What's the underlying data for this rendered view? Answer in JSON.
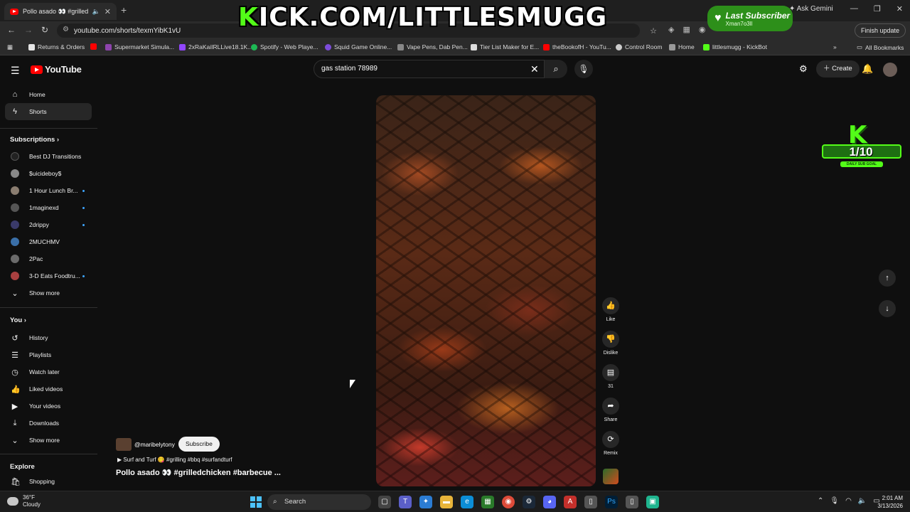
{
  "browser": {
    "tab_title": "Pollo asado 👀 #grilledchi",
    "url": "youtube.com/shorts/texmYibK1vU",
    "ask_gemini": "Ask Gemini",
    "finish_update": "Finish update",
    "bookmarks": [
      {
        "label": "Returns & Orders",
        "color": "#e5e5e5"
      },
      {
        "label": "",
        "color": "#ff0000"
      },
      {
        "label": "Supermarket Simula...",
        "color": "#8e44ad"
      },
      {
        "label": "2xRaKaiIRLLive18.1K...",
        "color": "#9146ff"
      },
      {
        "label": "Spotify - Web Playe...",
        "color": "#1db954"
      },
      {
        "label": "Squid Game Online...",
        "color": "#7d4cdb"
      },
      {
        "label": "Vape Pens, Dab Pen...",
        "color": "#888888"
      },
      {
        "label": "Tier List Maker for E...",
        "color": "#dddddd"
      },
      {
        "label": "theBookofH - YouTu...",
        "color": "#ff0000"
      },
      {
        "label": "Control Room",
        "color": "#cccccc"
      },
      {
        "label": "Home",
        "color": "#999999"
      },
      {
        "label": "littlesmugg - KickBot",
        "color": "#53fc18"
      }
    ],
    "all_bookmarks": "All Bookmarks"
  },
  "overlay": {
    "banner_k": "K",
    "banner_rest": "ICK.COM/LITTLESMUGG",
    "last_sub_title": "Last Subscriber",
    "last_sub_name": "Xman7o3ll",
    "goal_k": "K",
    "goal_count": "1/10",
    "goal_label": "DAILY SUB GOAL"
  },
  "yt": {
    "logo_text": "YouTube",
    "search_value": "gas station 78989",
    "create_label": "Create",
    "sidebar_top": [
      {
        "label": "Home",
        "icon": "home-icon",
        "glyph": "⌂",
        "active": false
      },
      {
        "label": "Shorts",
        "icon": "shorts-icon",
        "glyph": "ϟ",
        "active": true
      }
    ],
    "subscriptions_heading": "Subscriptions",
    "subscriptions": [
      {
        "label": "Best DJ Transitions",
        "color": "#222222",
        "live": false
      },
      {
        "label": "$uicideboy$",
        "color": "#888888",
        "live": false
      },
      {
        "label": "1 Hour Lunch Br...",
        "color": "#8a7d70",
        "live": true
      },
      {
        "label": "1maginexd",
        "color": "#555555",
        "live": true
      },
      {
        "label": "2drippy",
        "color": "#3a3a6a",
        "live": true
      },
      {
        "label": "2MUCHMV",
        "color": "#3a6fa8",
        "live": false
      },
      {
        "label": "2Pac",
        "color": "#6b6b6b",
        "live": false
      },
      {
        "label": "3-D Eats Foodtru...",
        "color": "#a84040",
        "live": true
      }
    ],
    "show_more": "Show more",
    "you_heading": "You",
    "you_items": [
      {
        "label": "History",
        "icon": "history-icon",
        "glyph": "↺"
      },
      {
        "label": "Playlists",
        "icon": "playlists-icon",
        "glyph": "☰"
      },
      {
        "label": "Watch later",
        "icon": "watch-later-icon",
        "glyph": "◷"
      },
      {
        "label": "Liked videos",
        "icon": "like-icon",
        "glyph": "👍"
      },
      {
        "label": "Your videos",
        "icon": "your-videos-icon",
        "glyph": "▶"
      },
      {
        "label": "Downloads",
        "icon": "download-icon",
        "glyph": "⤓"
      }
    ],
    "explore_heading": "Explore",
    "explore_items": [
      {
        "label": "Shopping",
        "icon": "shopping-icon",
        "glyph": "🛍"
      }
    ],
    "actions": [
      {
        "label": "Like",
        "icon": "like-icon",
        "glyph": "👍"
      },
      {
        "label": "Dislike",
        "icon": "dislike-icon",
        "glyph": "👎"
      },
      {
        "label": "31",
        "icon": "comment-icon",
        "glyph": "▤"
      },
      {
        "label": "Share",
        "icon": "share-icon",
        "glyph": "➦"
      },
      {
        "label": "Remix",
        "icon": "remix-icon",
        "glyph": "⟳"
      }
    ],
    "channel": "@maribelytony",
    "subscribe": "Subscribe",
    "sound_line": "Surf and Turf 😋 #grilling #bbq #surfandturf",
    "video_title": "Pollo asado 👀 #grilledchicken #barbecue ..."
  },
  "taskbar": {
    "temp": "36°F",
    "weather": "Cloudy",
    "search_label": "Search",
    "time": "2:01 AM",
    "date": "3/13/2026"
  }
}
